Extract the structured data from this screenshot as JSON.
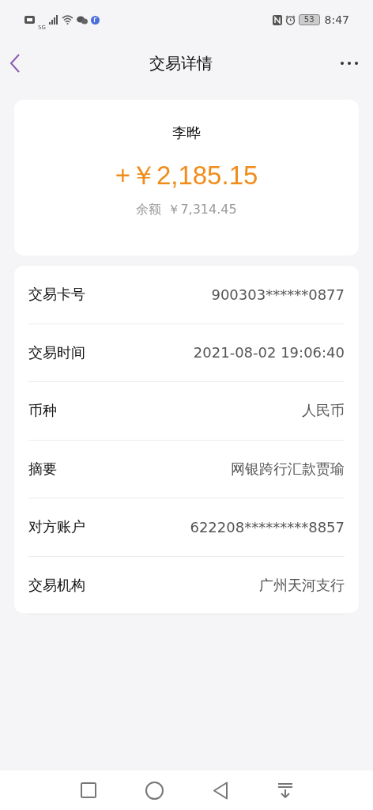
{
  "status_bar": {
    "network": "5G",
    "battery": "53",
    "time": "8:47"
  },
  "header": {
    "title": "交易详情"
  },
  "summary": {
    "name": "李晔",
    "amount": "+￥2,185.15",
    "balance_label": "余额",
    "balance": "￥7,314.45"
  },
  "details": [
    {
      "label": "交易卡号",
      "value": "900303******0877"
    },
    {
      "label": "交易时间",
      "value": "2021-08-02 19:06:40"
    },
    {
      "label": "币种",
      "value": "人民币"
    },
    {
      "label": "摘要",
      "value": "网银跨行汇款贾瑜"
    },
    {
      "label": "对方账户",
      "value": "622208*********8857"
    },
    {
      "label": "交易机构",
      "value": "广州天河支行"
    }
  ]
}
